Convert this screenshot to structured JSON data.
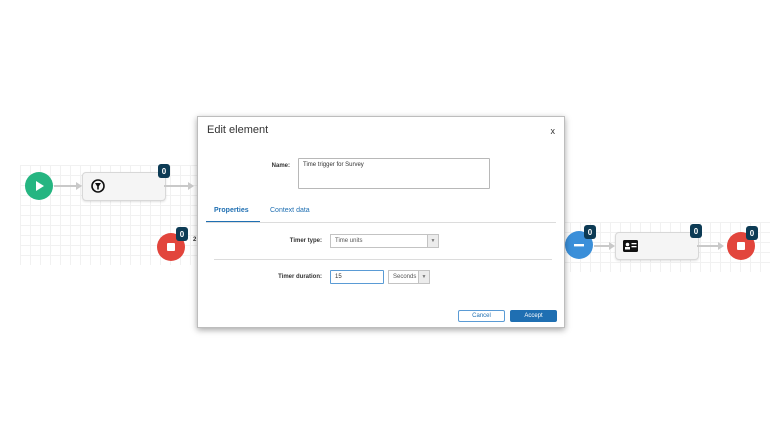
{
  "canvas": {
    "left_flow": {
      "filter_node_count": "0",
      "stop_node_count": "0",
      "edge_label": "2"
    },
    "right_flow": {
      "wait_node_count": "0",
      "card_node_count": "0",
      "stop_node_count": "0"
    }
  },
  "dialog": {
    "title": "Edit element",
    "close_label": "x",
    "name_label": "Name:",
    "name_value": "Time trigger for Survey",
    "tabs": [
      {
        "label": "Properties",
        "active": true
      },
      {
        "label": "Context data",
        "active": false
      }
    ],
    "timer_type_label": "Timer type:",
    "timer_type_value": "Time units",
    "timer_duration_label": "Timer duration:",
    "timer_duration_value": "15",
    "timer_unit_value": "Seconds",
    "cancel_label": "Cancel",
    "accept_label": "Accept"
  },
  "colors": {
    "accent": "#1f6fb2",
    "start_green": "#25b581",
    "stop_red": "#e2453c",
    "wait_blue": "#3b8fd9",
    "counter_navy": "#0d3b55"
  },
  "icons": [
    "play-icon",
    "filter-icon",
    "stop-icon",
    "minus-icon",
    "id-card-icon",
    "dropdown-arrow-icon"
  ]
}
